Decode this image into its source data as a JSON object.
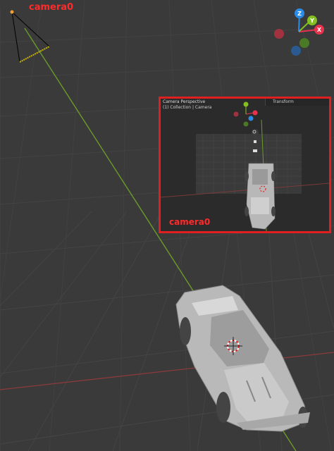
{
  "viewport": {
    "camera_label": "camera0"
  },
  "camera_preview": {
    "header_line1": "Camera Perspective",
    "header_line2": "(1) Collection | Camera",
    "sidebar_title": "Transform",
    "camera_label": "camera0"
  },
  "gizmo": {
    "axes": [
      "X",
      "Y",
      "Z"
    ]
  },
  "colors": {
    "label_red": "#ff2a2a",
    "frame_red": "#e02020",
    "axis_x": "#e8334f",
    "axis_y": "#84c021",
    "axis_z": "#2b8ce6"
  }
}
